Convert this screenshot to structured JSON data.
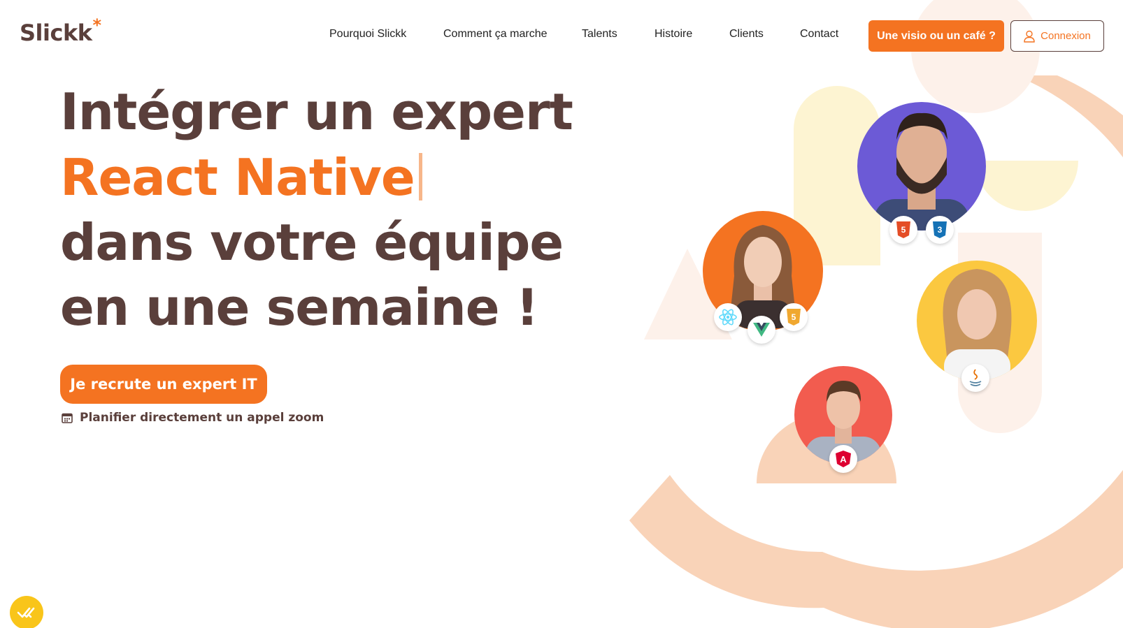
{
  "brand": {
    "name": "Slickk",
    "mark": "*",
    "accent": "#f47321",
    "text_color": "#5a3f3b"
  },
  "nav": {
    "items": [
      "Pourquoi Slickk",
      "Comment ça marche",
      "Talents",
      "Histoire",
      "Clients",
      "Contact"
    ],
    "cta_label": "Une visio ou un café ?",
    "login_label": "Connexion",
    "login_icon": "user-icon"
  },
  "hero": {
    "line1": "Intégrer un expert",
    "line2": "React Native",
    "line3": "dans votre équipe",
    "line4": "en une semaine !",
    "button_label": "Je recrute un expert IT",
    "zoom_label": "Planifier directement un appel zoom",
    "zoom_icon": "calendar-icon"
  },
  "talents": [
    {
      "name": "talent-bearded-man",
      "bg": "#6c5ad6",
      "badges": [
        "HTML",
        "CSS"
      ]
    },
    {
      "name": "talent-woman-orange",
      "bg": "#f47321",
      "badges": [
        "React",
        "Vue",
        "JS"
      ]
    },
    {
      "name": "talent-woman-yellow",
      "bg": "#fbc840",
      "badges": [
        "Java"
      ]
    },
    {
      "name": "talent-man-red",
      "bg": "#f25c4f",
      "badges": [
        "Angular"
      ]
    }
  ],
  "badge_text": {
    "html": "HTML",
    "css": "CSS",
    "js": "JS",
    "five": "5",
    "three": "3",
    "angular": "A"
  }
}
